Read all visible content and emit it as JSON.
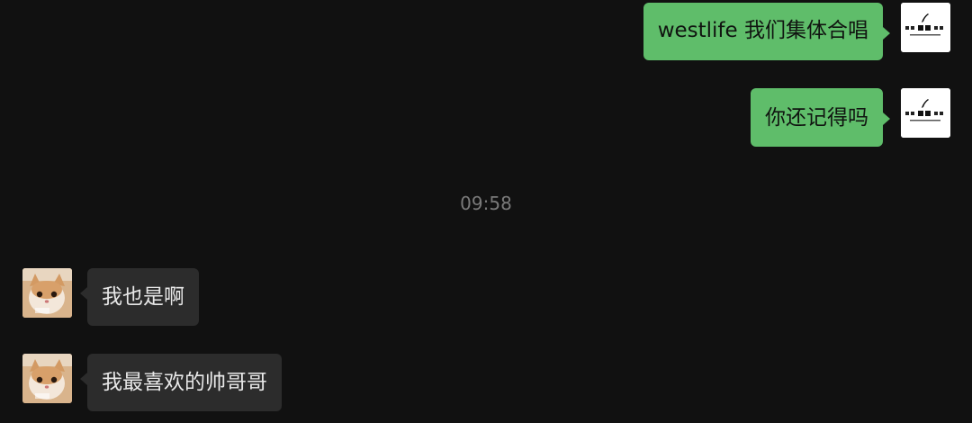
{
  "timestamp": "09:58",
  "messages": [
    {
      "direction": "out",
      "text": "westlife 我们集体合唱",
      "avatar": "music-logo-avatar"
    },
    {
      "direction": "out",
      "text": "你还记得吗",
      "avatar": "music-logo-avatar"
    },
    {
      "direction": "in",
      "text": "我也是啊",
      "avatar": "cat-avatar"
    },
    {
      "direction": "in",
      "text": "我最喜欢的帅哥哥",
      "avatar": "cat-avatar"
    }
  ],
  "colors": {
    "background": "#111111",
    "outgoing_bubble": "#5fbd6a",
    "incoming_bubble": "#2c2c2c",
    "timestamp_text": "#7a7a7a"
  }
}
